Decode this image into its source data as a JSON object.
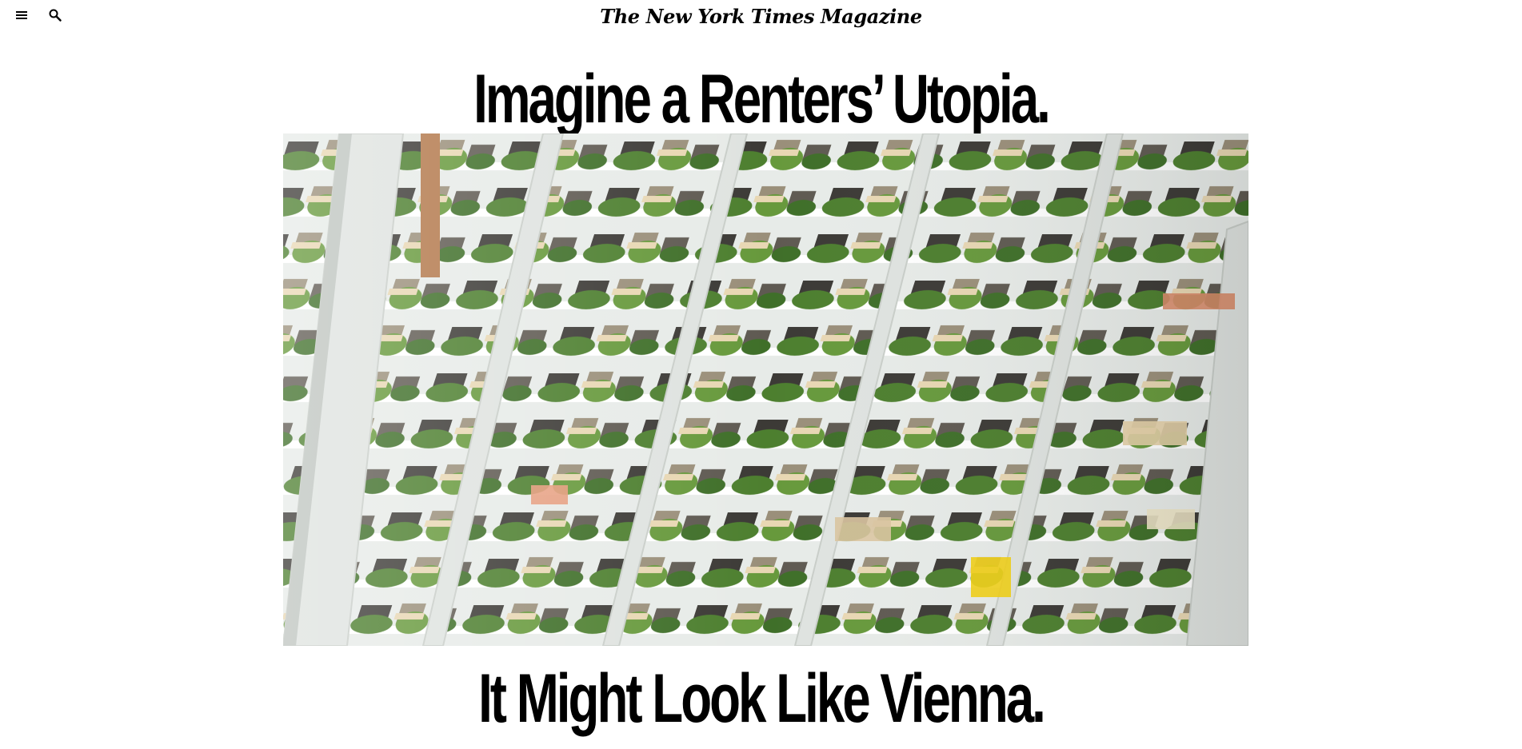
{
  "header": {
    "masthead": "The New York Times Magazine",
    "menu_icon": "menu-icon",
    "search_icon": "search-icon"
  },
  "article": {
    "headline_top": "Imagine a Renters’ Utopia.",
    "headline_bottom": "It Might Look Like Vienna.",
    "hero_image": "terraced-apartment-balconies-with-plants"
  },
  "colors": {
    "background": "#ffffff",
    "text": "#000000",
    "building": "#e9ecea",
    "greenery": "#4d7f2f"
  }
}
